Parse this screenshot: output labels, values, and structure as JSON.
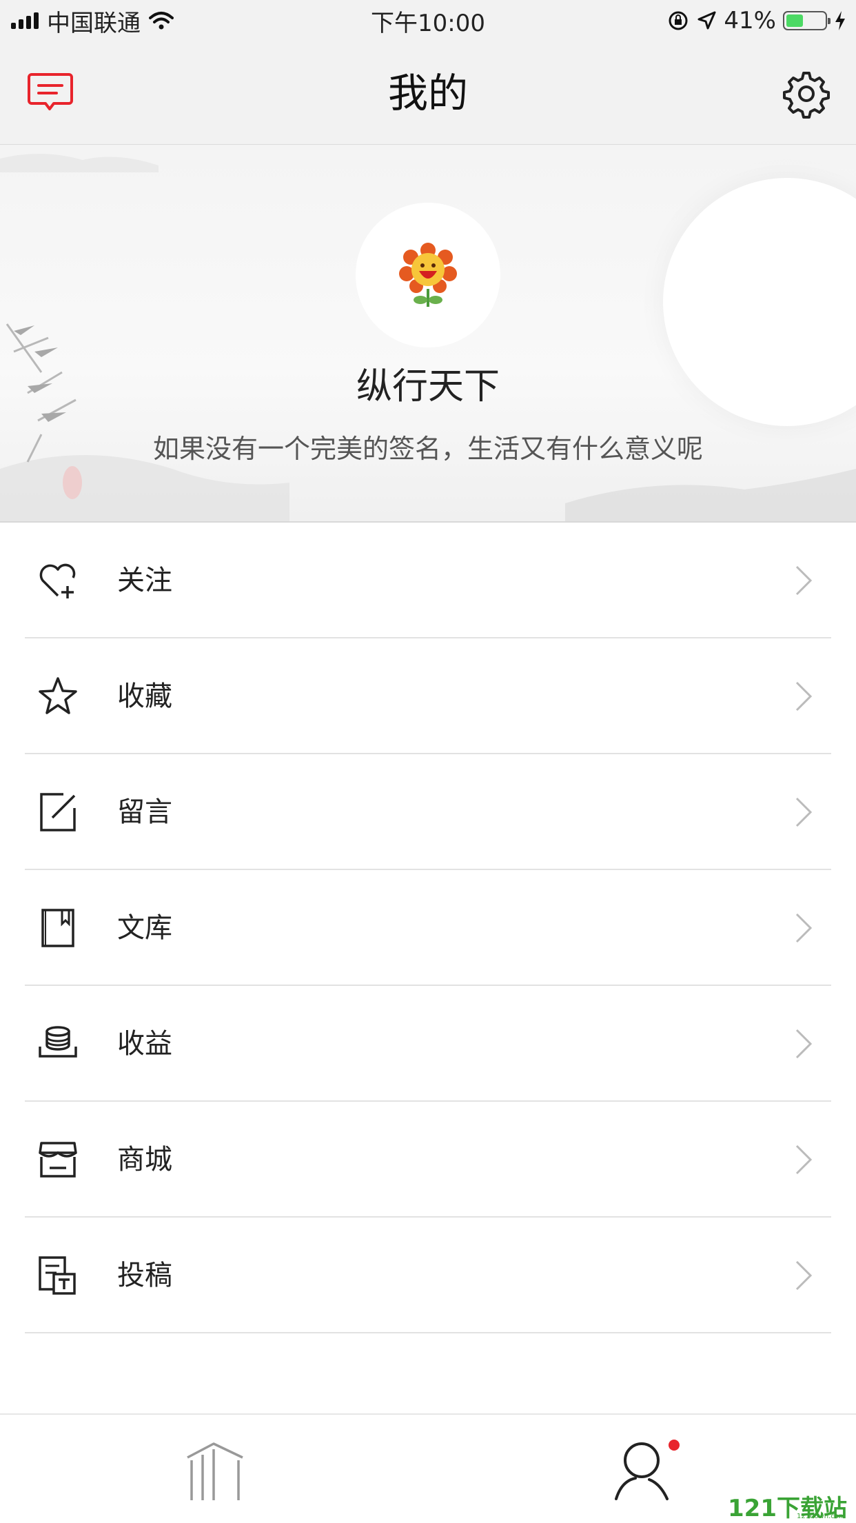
{
  "status_bar": {
    "carrier": "中国联通",
    "time": "下午10:00",
    "battery": "41%",
    "battery_level": 0.41
  },
  "nav": {
    "title": "我的"
  },
  "profile": {
    "name": "纵行天下",
    "signature": "如果没有一个完美的签名，生活又有什么意义呢"
  },
  "menu": [
    {
      "label": "关注",
      "icon": "heart-plus-icon"
    },
    {
      "label": "收藏",
      "icon": "star-icon"
    },
    {
      "label": "留言",
      "icon": "edit-icon"
    },
    {
      "label": "文库",
      "icon": "book-icon"
    },
    {
      "label": "收益",
      "icon": "coins-icon"
    },
    {
      "label": "商城",
      "icon": "store-icon"
    },
    {
      "label": "投稿",
      "icon": "document-icon"
    }
  ],
  "tab_bar": {
    "items": [
      "home-icon",
      "user-icon"
    ],
    "active": "user-icon",
    "badge": "red-dot"
  },
  "watermark": {
    "text": "121下载站",
    "sub": "121down.com"
  },
  "colors": {
    "accent": "#e8242c",
    "background": "#f2f2f2",
    "battery_green": "#4cd964"
  }
}
